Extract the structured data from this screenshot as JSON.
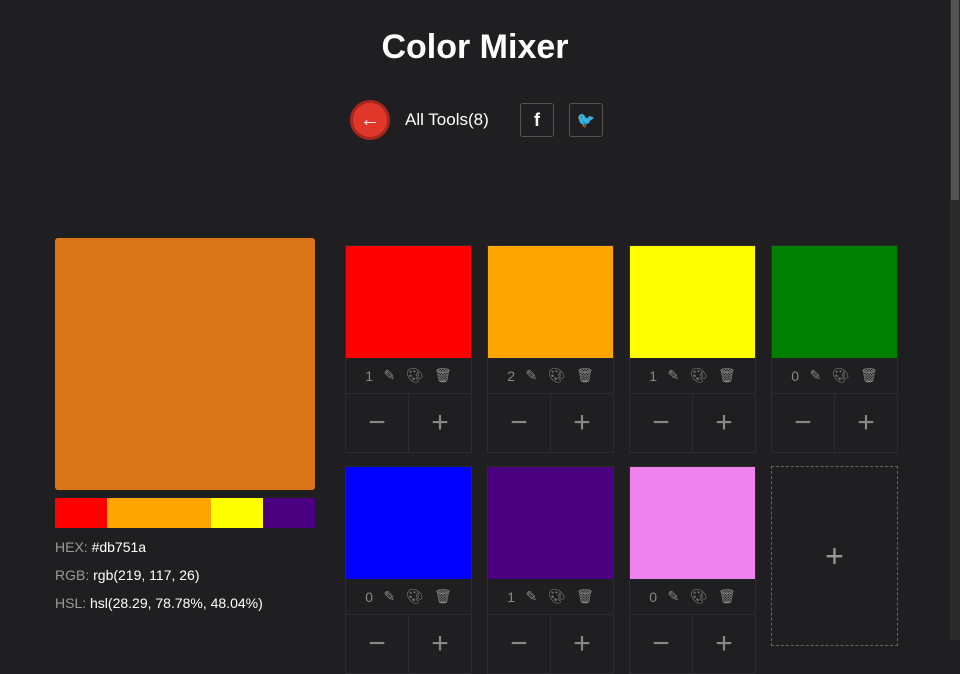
{
  "title": "Color Mixer",
  "nav": {
    "all_tools": "All Tools(8)"
  },
  "result": {
    "color": "#db751a",
    "hex_label": "HEX:",
    "hex": "#db751a",
    "rgb_label": "RGB:",
    "rgb": "rgb(219, 117, 26)",
    "hsl_label": "HSL:",
    "hsl": "hsl(28.29, 78.78%, 48.04%)",
    "mix": [
      {
        "color": "#ff0000",
        "parts": 1
      },
      {
        "color": "#ffa500",
        "parts": 2
      },
      {
        "color": "#ffff00",
        "parts": 1
      },
      {
        "color": "#4b0082",
        "parts": 1
      }
    ]
  },
  "colors": [
    {
      "color": "#ff0000",
      "count": "1"
    },
    {
      "color": "#ffa500",
      "count": "2"
    },
    {
      "color": "#ffff00",
      "count": "1"
    },
    {
      "color": "#008000",
      "count": "0"
    },
    {
      "color": "#0000ff",
      "count": "0"
    },
    {
      "color": "#4b0082",
      "count": "1"
    },
    {
      "color": "#ee82ee",
      "count": "0"
    }
  ]
}
